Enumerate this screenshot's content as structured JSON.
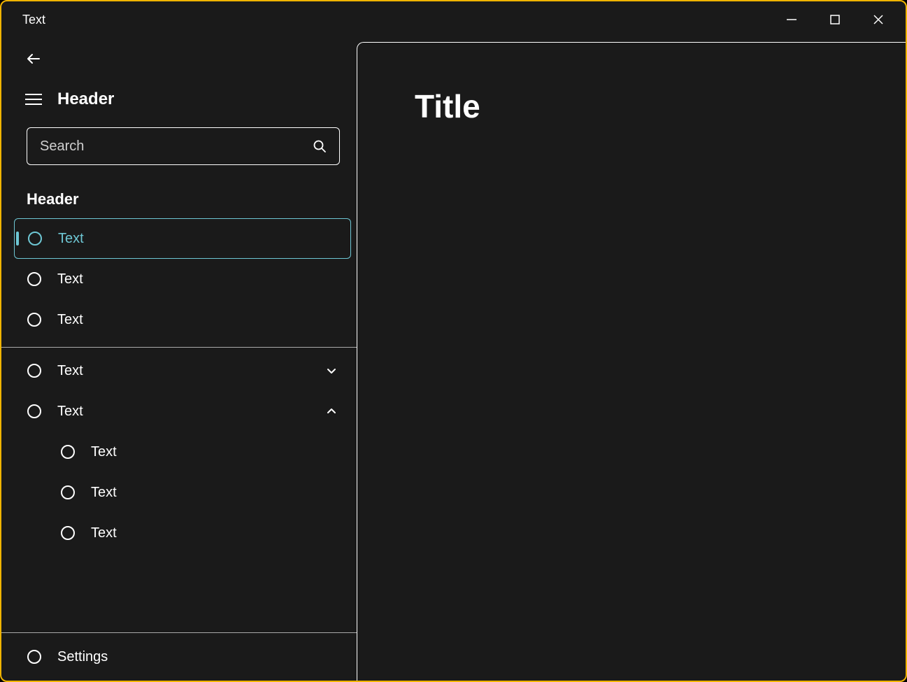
{
  "window": {
    "title": "Text"
  },
  "sidebar": {
    "header_label": "Header",
    "search_placeholder": "Search",
    "section_header": "Header",
    "group1": [
      {
        "label": "Text",
        "selected": true
      },
      {
        "label": "Text"
      },
      {
        "label": "Text"
      }
    ],
    "group2": [
      {
        "label": "Text",
        "expand": "down"
      },
      {
        "label": "Text",
        "expand": "up",
        "children": [
          {
            "label": "Text"
          },
          {
            "label": "Text"
          },
          {
            "label": "Text"
          }
        ]
      }
    ],
    "footer_label": "Settings"
  },
  "main": {
    "title": "Title"
  },
  "colors": {
    "accent": "#6ec7d4",
    "border": "#f0b400",
    "bg": "#1a1a1a"
  }
}
